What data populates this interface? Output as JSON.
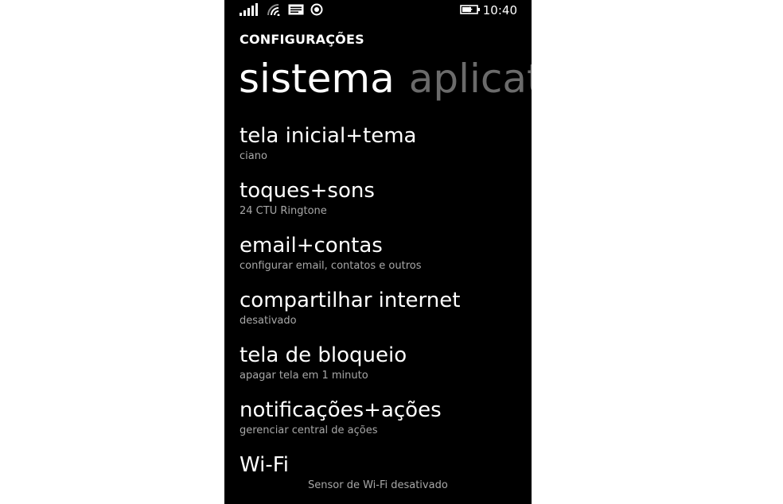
{
  "status_bar": {
    "time": "10:40",
    "icons": [
      "signal-strength-icon",
      "wifi-icon",
      "message-icon",
      "location-icon",
      "battery-icon"
    ]
  },
  "header": {
    "app_title": "CONFIGURAÇÕES"
  },
  "pivot": {
    "tabs": [
      {
        "label": "sistema",
        "active": true
      },
      {
        "label": "aplicati",
        "active": false
      }
    ]
  },
  "settings": {
    "items": [
      {
        "title": "tela inicial+tema",
        "subtitle": "ciano"
      },
      {
        "title": "toques+sons",
        "subtitle": "24 CTU Ringtone"
      },
      {
        "title": "email+contas",
        "subtitle": "configurar email, contatos e outros"
      },
      {
        "title": "compartilhar internet",
        "subtitle": "desativado"
      },
      {
        "title": "tela de bloqueio",
        "subtitle": "apagar tela em 1 minuto"
      },
      {
        "title": "notificações+ações",
        "subtitle": "gerenciar central de ações"
      },
      {
        "title": "Wi-Fi",
        "subtitle": "Sensor de Wi-Fi desativado"
      }
    ]
  },
  "colors": {
    "background": "#000000",
    "text_primary": "#ffffff",
    "text_secondary": "#a8a8a8",
    "pivot_inactive": "#6b6b6b",
    "page_background": "#ffffff"
  }
}
